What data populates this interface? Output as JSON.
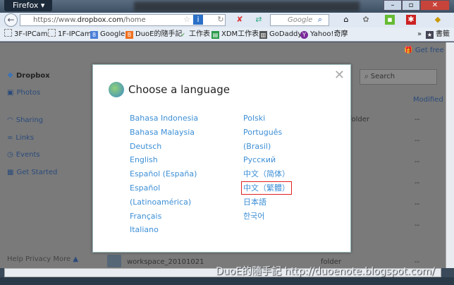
{
  "browser": {
    "menu_label": "Firefox",
    "url_prefix": "https://www.",
    "url_domain": "dropbox.com",
    "url_path": "/home",
    "search_placeholder": "Google",
    "bookmarks": [
      "3F-IPCam",
      "1F-IPCam",
      "Google",
      "DuoE的隨手記",
      "工作表",
      "XDM工作表",
      "GoDaddy",
      "Yahoo!奇摩"
    ],
    "bookmarks_menu": "書籤"
  },
  "dropbox": {
    "brand": "Dropbox",
    "nav": [
      "Photos",
      "Sharing",
      "Links",
      "Events",
      "Get Started"
    ],
    "get_free_space": "Get free s",
    "search_placeholder": "Search",
    "modified_header": "Modified",
    "footer_links": [
      "Help",
      "Privacy",
      "More"
    ],
    "row_name": "workspace_20101021",
    "row_kind": "folder",
    "row_kind_top": "folder",
    "dash": "--"
  },
  "modal": {
    "title": "Choose a language",
    "left": [
      "Bahasa Indonesia",
      "Bahasa Malaysia",
      "Deutsch",
      "English",
      "Español (España)",
      "Español",
      "(Latinoamérica)",
      "Français",
      "Italiano"
    ],
    "right": [
      "Polski",
      "Português",
      "(Brasil)",
      "Русский",
      "中文（简体）",
      "中文（繁體）",
      "日本語",
      "한국어"
    ]
  },
  "watermark": "DuoE的隨手記  http://duoenote.blogspot.com/",
  "colors": {
    "link": "#3d8fd6",
    "highlight": "#e02020"
  }
}
